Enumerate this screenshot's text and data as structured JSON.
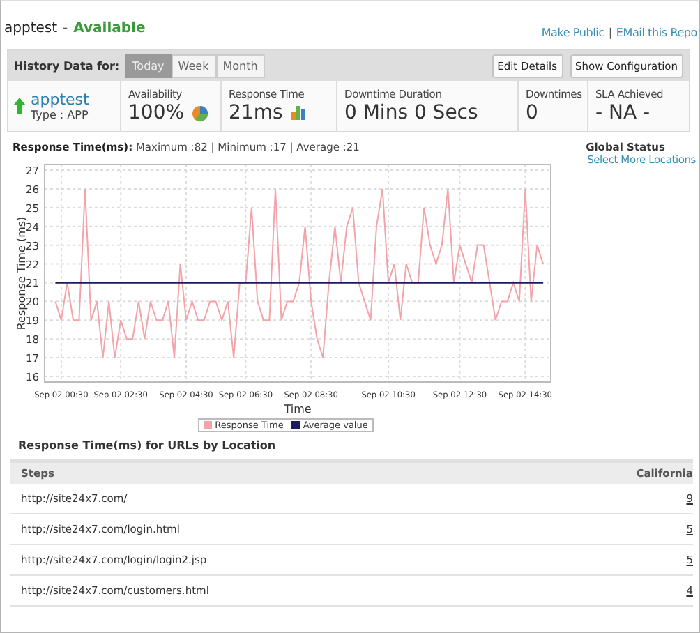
{
  "header": {
    "monitor_name": "apptest",
    "separator": "-",
    "status": "Available",
    "links": [
      "Make Public",
      "EMail this Repo"
    ],
    "links_separator": "|"
  },
  "toolbar": {
    "label": "History Data for:",
    "tabs": [
      {
        "label": "Today",
        "selected": true
      },
      {
        "label": "Week",
        "selected": false
      },
      {
        "label": "Month",
        "selected": false
      }
    ],
    "buttons": [
      "Edit Details",
      "Show Configuration"
    ]
  },
  "summary": {
    "name": "apptest",
    "type": "Type : APP",
    "stats": [
      {
        "label": "Availability",
        "value": "100%",
        "kind": "pie"
      },
      {
        "label": "Response Time",
        "value": "21ms",
        "kind": "bars"
      },
      {
        "label": "Downtime Duration",
        "value": "0 Mins 0 Secs",
        "kind": "plain"
      },
      {
        "label": "Downtimes",
        "value": "0",
        "kind": "plain"
      },
      {
        "label": "SLA Achieved",
        "value": "- NA -",
        "kind": "plain"
      }
    ]
  },
  "chart": {
    "heading": "**Response Time(ms):** Maximum :82 | Minimum :17 | Average :21",
    "chart_data": {
      "type": "line",
      "grid": true,
      "xlabel": "Time",
      "ylabel": "Response Time (ms)",
      "ylim": [
        15.7,
        27.3
      ],
      "yticks": [
        16,
        17,
        18,
        19,
        20,
        21,
        22,
        23,
        24,
        25,
        26,
        27
      ],
      "categories": [
        null,
        "Sep 02 00:30",
        null,
        null,
        null,
        null,
        null,
        null,
        null,
        null,
        null,
        "Sep 02 02:30",
        null,
        null,
        null,
        null,
        null,
        null,
        null,
        null,
        null,
        null,
        "Sep 02 04:30",
        null,
        null,
        null,
        null,
        null,
        null,
        null,
        null,
        null,
        "Sep 02 06:30",
        null,
        null,
        null,
        null,
        null,
        null,
        null,
        null,
        null,
        null,
        "Sep 02 08:30",
        null,
        null,
        null,
        null,
        null,
        null,
        null,
        null,
        null,
        null,
        null,
        null,
        "Sep 02 10:30",
        null,
        null,
        null,
        null,
        null,
        null,
        null,
        null,
        null,
        null,
        null,
        "Sep 02 12:30",
        null,
        null,
        null,
        null,
        null,
        null,
        null,
        null,
        null,
        null,
        "Sep 02 14:30",
        null,
        null,
        null
      ],
      "series": [
        {
          "name": "Response Time",
          "color": "#f4a3a8",
          "values": [
            20,
            19,
            21,
            19,
            19,
            26,
            19,
            20,
            17,
            20,
            17,
            19,
            18,
            18,
            20,
            18,
            20,
            19,
            19,
            20,
            17,
            22,
            19,
            20,
            19,
            19,
            20,
            20,
            19,
            20,
            17,
            21,
            21,
            25,
            20,
            19,
            19,
            26,
            19,
            20,
            20,
            21,
            24,
            20,
            18,
            17,
            21,
            24,
            21,
            24,
            25,
            21,
            20,
            19,
            24,
            26,
            21,
            22,
            19,
            22,
            21,
            21,
            25,
            23,
            22,
            23,
            26,
            21,
            23,
            22,
            21,
            23,
            23,
            21,
            19,
            20,
            20,
            21,
            20,
            26,
            20,
            23,
            22
          ]
        },
        {
          "name": "Average value",
          "color": "#1c1c5c",
          "values": [
            21,
            21,
            21,
            21,
            21,
            21,
            21,
            21,
            21,
            21,
            21,
            21,
            21,
            21,
            21,
            21,
            21,
            21,
            21,
            21,
            21,
            21,
            21,
            21,
            21,
            21,
            21,
            21,
            21,
            21,
            21,
            21,
            21,
            21,
            21,
            21,
            21,
            21,
            21,
            21,
            21,
            21,
            21,
            21,
            21,
            21,
            21,
            21,
            21,
            21,
            21,
            21,
            21,
            21,
            21,
            21,
            21,
            21,
            21,
            21,
            21,
            21,
            21,
            21,
            21,
            21,
            21,
            21,
            21,
            21,
            21,
            21,
            21,
            21,
            21,
            21,
            21,
            21,
            21,
            21,
            21,
            21,
            21
          ]
        }
      ]
    }
  },
  "global_status": {
    "title": "Global Status",
    "link": "Select More Locations"
  },
  "url_table": {
    "title": "Response Time(ms) for URLs by Location",
    "columns": [
      "Steps",
      "California"
    ],
    "rows": [
      {
        "step": "http://site24x7.com/",
        "california": "9"
      },
      {
        "step": "http://site24x7.com/login.html",
        "california": "5"
      },
      {
        "step": "http://site24x7.com/login/login2.jsp",
        "california": "5"
      },
      {
        "step": "http://site24x7.com/customers.html",
        "california": "4"
      }
    ]
  }
}
